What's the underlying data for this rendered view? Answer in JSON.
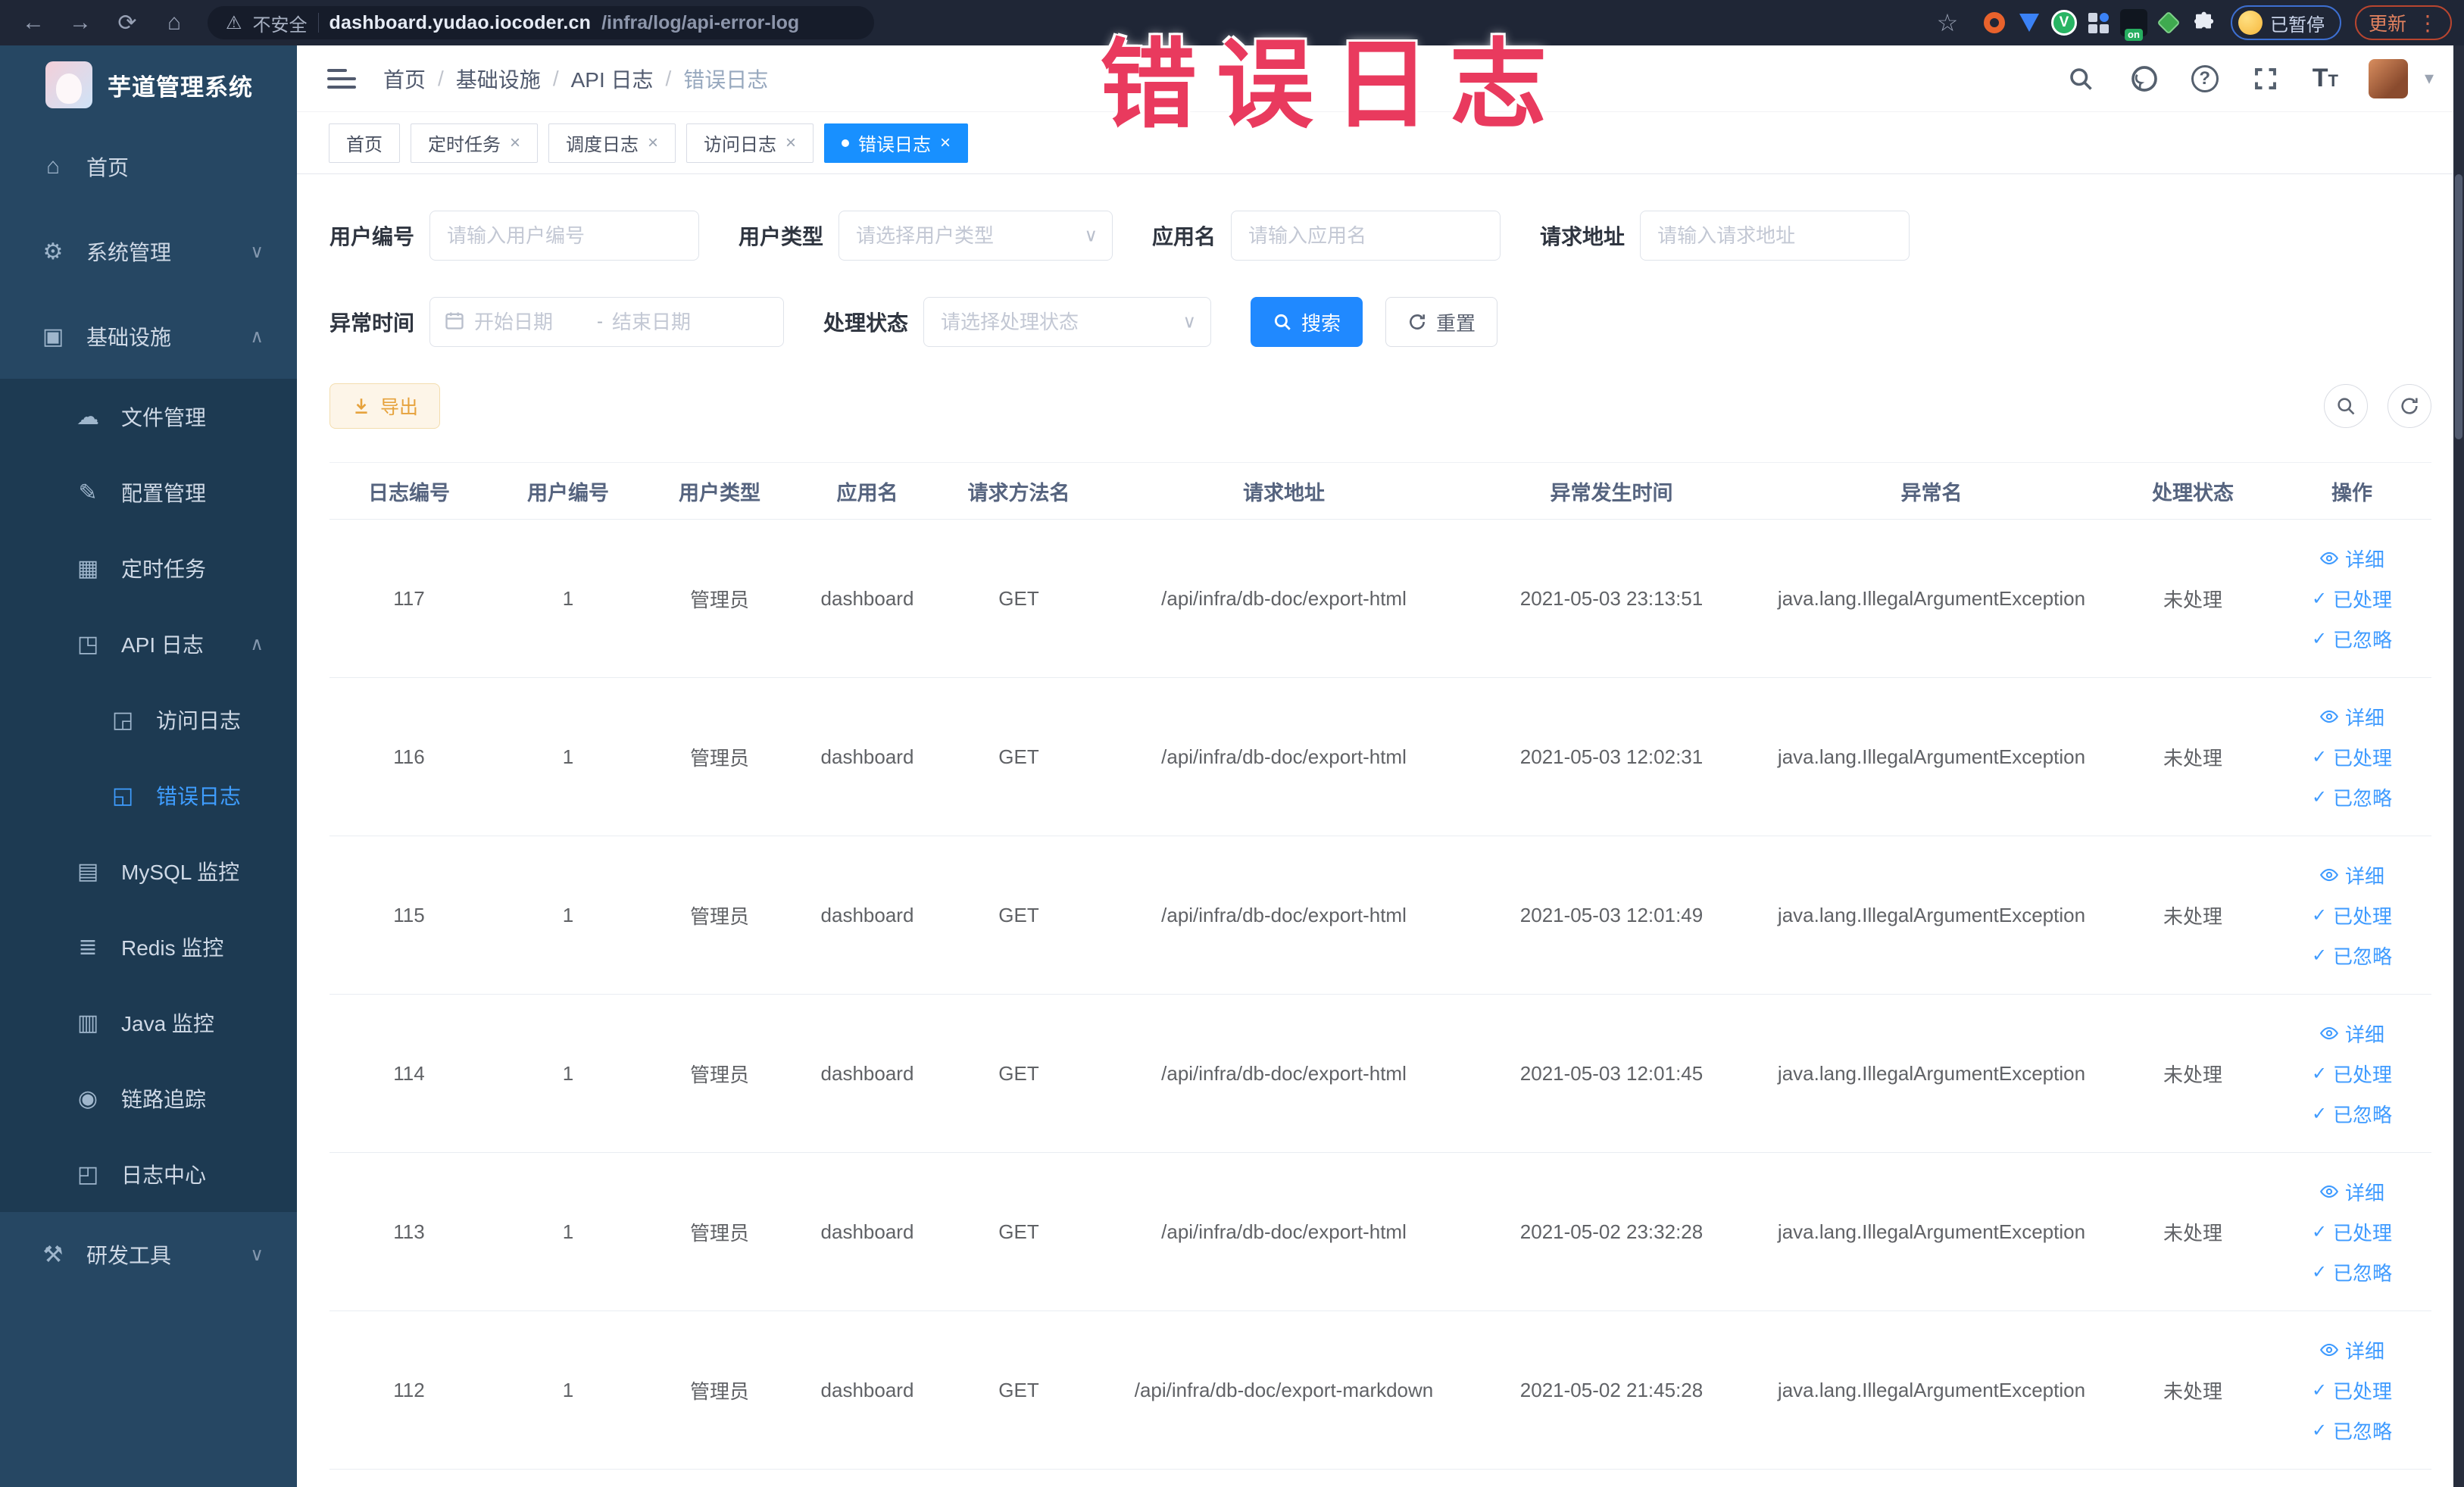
{
  "browser": {
    "security_label": "不安全",
    "url_host": "dashboard.yudao.iocoder.cn",
    "url_path": "/infra/log/api-error-log",
    "paused_label": "已暂停",
    "update_label": "更新",
    "extension_badge_on": "on"
  },
  "overlay": {
    "text": "错误日志",
    "color": "#e93a5e"
  },
  "sidebar": {
    "app_title": "芋道管理系统",
    "menu": [
      {
        "label": "首页",
        "icon": "home-icon",
        "level": 1
      },
      {
        "label": "系统管理",
        "icon": "gear-icon",
        "level": 1,
        "chevron": "down"
      },
      {
        "label": "基础设施",
        "icon": "infra-icon",
        "level": 1,
        "chevron": "up"
      },
      {
        "label": "文件管理",
        "icon": "file-manage-icon",
        "level": 2,
        "group": true
      },
      {
        "label": "配置管理",
        "icon": "config-icon",
        "level": 2,
        "group": true
      },
      {
        "label": "定时任务",
        "icon": "job-icon",
        "level": 2,
        "group": true
      },
      {
        "label": "API 日志",
        "icon": "api-log-icon",
        "level": 2,
        "group": true,
        "chevron": "up"
      },
      {
        "label": "访问日志",
        "icon": "access-log-icon",
        "level": 3,
        "group": true
      },
      {
        "label": "错误日志",
        "icon": "error-log-icon",
        "level": 3,
        "group": true,
        "active": true
      },
      {
        "label": "MySQL 监控",
        "icon": "mysql-icon",
        "level": 2,
        "group": true
      },
      {
        "label": "Redis 监控",
        "icon": "redis-icon",
        "level": 2,
        "group": true
      },
      {
        "label": "Java 监控",
        "icon": "java-icon",
        "level": 2,
        "group": true
      },
      {
        "label": "链路追踪",
        "icon": "trace-icon",
        "level": 2,
        "group": true
      },
      {
        "label": "日志中心",
        "icon": "log-center-icon",
        "level": 2,
        "group": true
      },
      {
        "label": "研发工具",
        "icon": "devtools-icon",
        "level": 1,
        "chevron": "down"
      }
    ]
  },
  "header": {
    "breadcrumbs": [
      "首页",
      "基础设施",
      "API 日志",
      "错误日志"
    ]
  },
  "tabs": [
    {
      "label": "首页",
      "closable": false,
      "active": false
    },
    {
      "label": "定时任务",
      "closable": true,
      "active": false
    },
    {
      "label": "调度日志",
      "closable": true,
      "active": false
    },
    {
      "label": "访问日志",
      "closable": true,
      "active": false
    },
    {
      "label": "错误日志",
      "closable": true,
      "active": true
    }
  ],
  "filters": {
    "row1": [
      {
        "label": "用户编号",
        "placeholder": "请输入用户编号"
      },
      {
        "label": "用户类型",
        "placeholder": "请选择用户类型"
      },
      {
        "label": "应用名",
        "placeholder": "请输入应用名"
      },
      {
        "label": "请求地址",
        "placeholder": "请输入请求地址"
      }
    ],
    "row2": {
      "time_label": "异常时间",
      "start_placeholder": "开始日期",
      "range_separator": "-",
      "end_placeholder": "结束日期",
      "status_label": "处理状态",
      "status_placeholder": "请选择处理状态"
    },
    "search_label": "搜索",
    "reset_label": "重置"
  },
  "toolbar": {
    "export_label": "导出"
  },
  "table": {
    "columns": [
      "日志编号",
      "用户编号",
      "用户类型",
      "应用名",
      "请求方法名",
      "请求地址",
      "异常发生时间",
      "异常名",
      "处理状态",
      "操作"
    ],
    "actions": [
      "详细",
      "已处理",
      "已忽略"
    ],
    "rows": [
      {
        "id": "117",
        "user_id": "1",
        "user_type": "管理员",
        "app": "dashboard",
        "method": "GET",
        "url": "/api/infra/db-doc/export-html",
        "time": "2021-05-03 23:13:51",
        "exception": "java.lang.IllegalArgumentException",
        "status": "未处理"
      },
      {
        "id": "116",
        "user_id": "1",
        "user_type": "管理员",
        "app": "dashboard",
        "method": "GET",
        "url": "/api/infra/db-doc/export-html",
        "time": "2021-05-03 12:02:31",
        "exception": "java.lang.IllegalArgumentException",
        "status": "未处理"
      },
      {
        "id": "115",
        "user_id": "1",
        "user_type": "管理员",
        "app": "dashboard",
        "method": "GET",
        "url": "/api/infra/db-doc/export-html",
        "time": "2021-05-03 12:01:49",
        "exception": "java.lang.IllegalArgumentException",
        "status": "未处理"
      },
      {
        "id": "114",
        "user_id": "1",
        "user_type": "管理员",
        "app": "dashboard",
        "method": "GET",
        "url": "/api/infra/db-doc/export-html",
        "time": "2021-05-03 12:01:45",
        "exception": "java.lang.IllegalArgumentException",
        "status": "未处理"
      },
      {
        "id": "113",
        "user_id": "1",
        "user_type": "管理员",
        "app": "dashboard",
        "method": "GET",
        "url": "/api/infra/db-doc/export-html",
        "time": "2021-05-02 23:32:28",
        "exception": "java.lang.IllegalArgumentException",
        "status": "未处理"
      },
      {
        "id": "112",
        "user_id": "1",
        "user_type": "管理员",
        "app": "dashboard",
        "method": "GET",
        "url": "/api/infra/db-doc/export-markdown",
        "time": "2021-05-02 21:45:28",
        "exception": "java.lang.IllegalArgumentException",
        "status": "未处理"
      }
    ]
  }
}
